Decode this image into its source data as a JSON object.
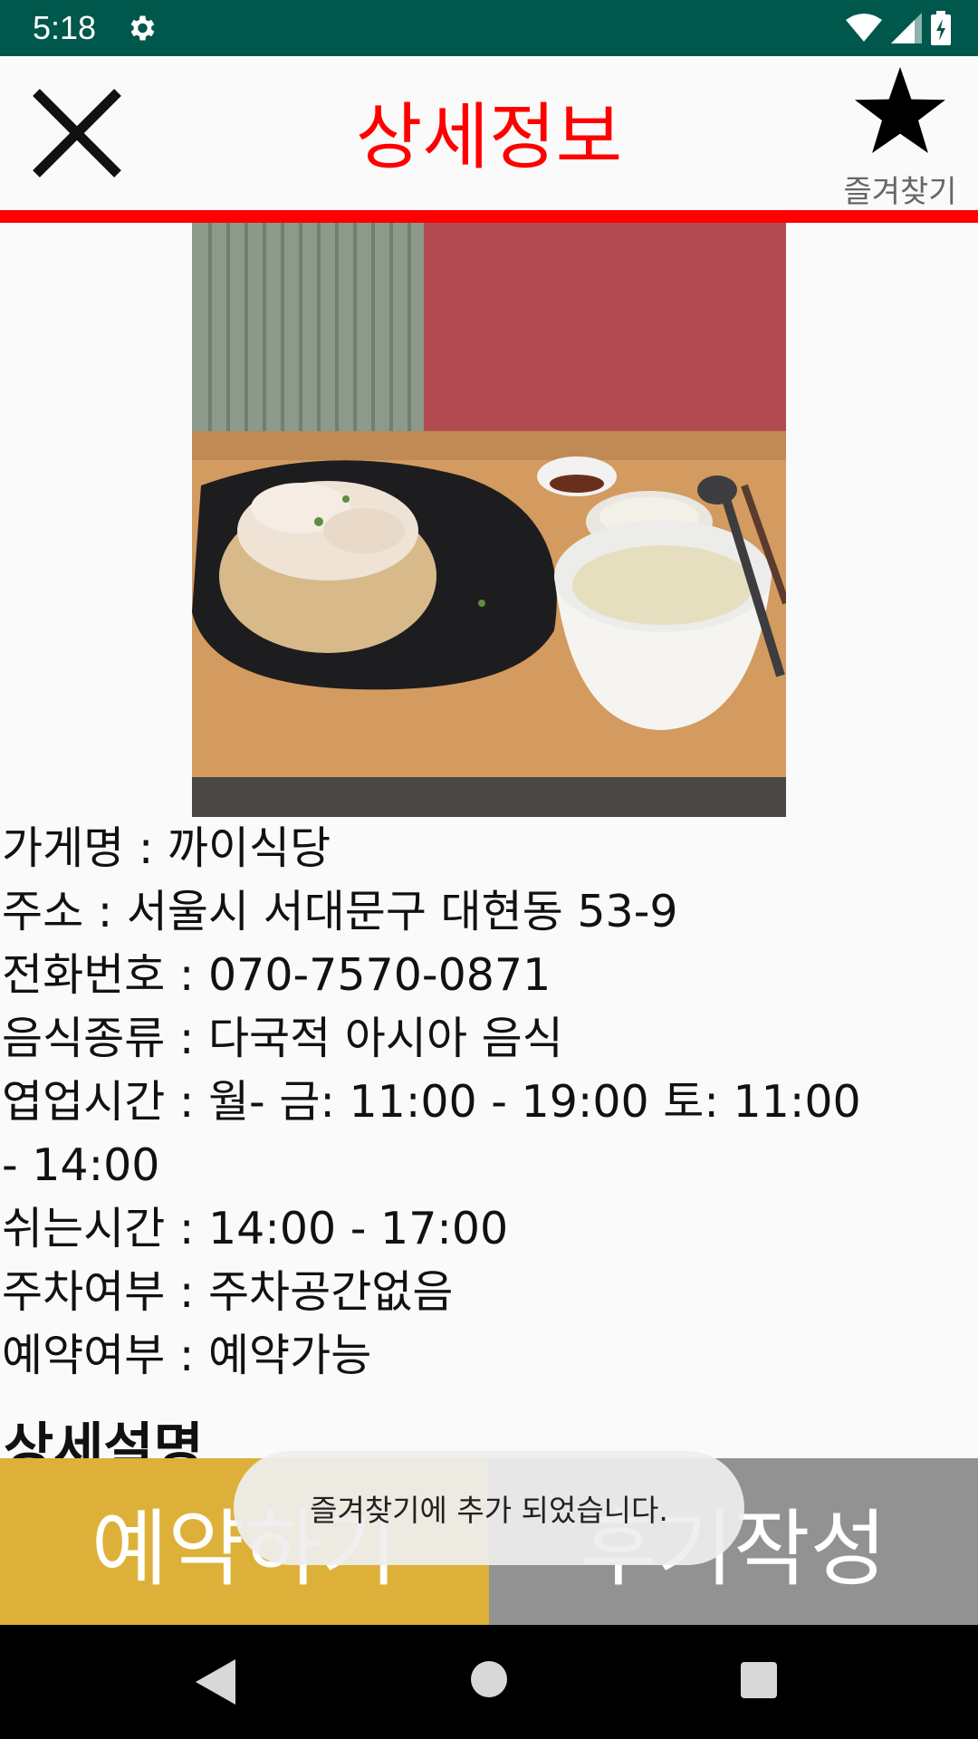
{
  "status_bar": {
    "time": "5:18",
    "icons": [
      "gear-icon",
      "wifi-icon",
      "signal-icon",
      "battery-icon"
    ]
  },
  "header": {
    "title": "상세정보",
    "favorite_label": "즐겨찾기",
    "title_color": "#ff0000",
    "accent_rule_color": "#ff0000"
  },
  "restaurant": {
    "name_line": "가게명 : 까이식당",
    "address_line": "주소 : 서울시 서대문구 대현동 53-9",
    "phone_line": "전화번호 : 070-7570-0871",
    "cuisine_line": "음식종류 : 다국적 아시아 음식",
    "hours_line": "엽업시간 : 월- 금: 11:00 - 19:00 토: 11:00 - 14:00",
    "break_line": "쉬는시간 : 14:00 - 17:00",
    "parking_line": "주차여부 : 주차공간없음",
    "reservation_line": "예약여부 : 예약가능"
  },
  "detail_heading": "상세설명",
  "actions": {
    "reserve_label": "예약하기",
    "review_label": "후기작성",
    "reserve_color": "#ddb139",
    "review_color": "#929292"
  },
  "toast": {
    "message": "즐겨찾기에 추가 되었습니다."
  },
  "nav_bar": {
    "icons": [
      "back-icon",
      "home-icon",
      "recents-icon"
    ]
  }
}
